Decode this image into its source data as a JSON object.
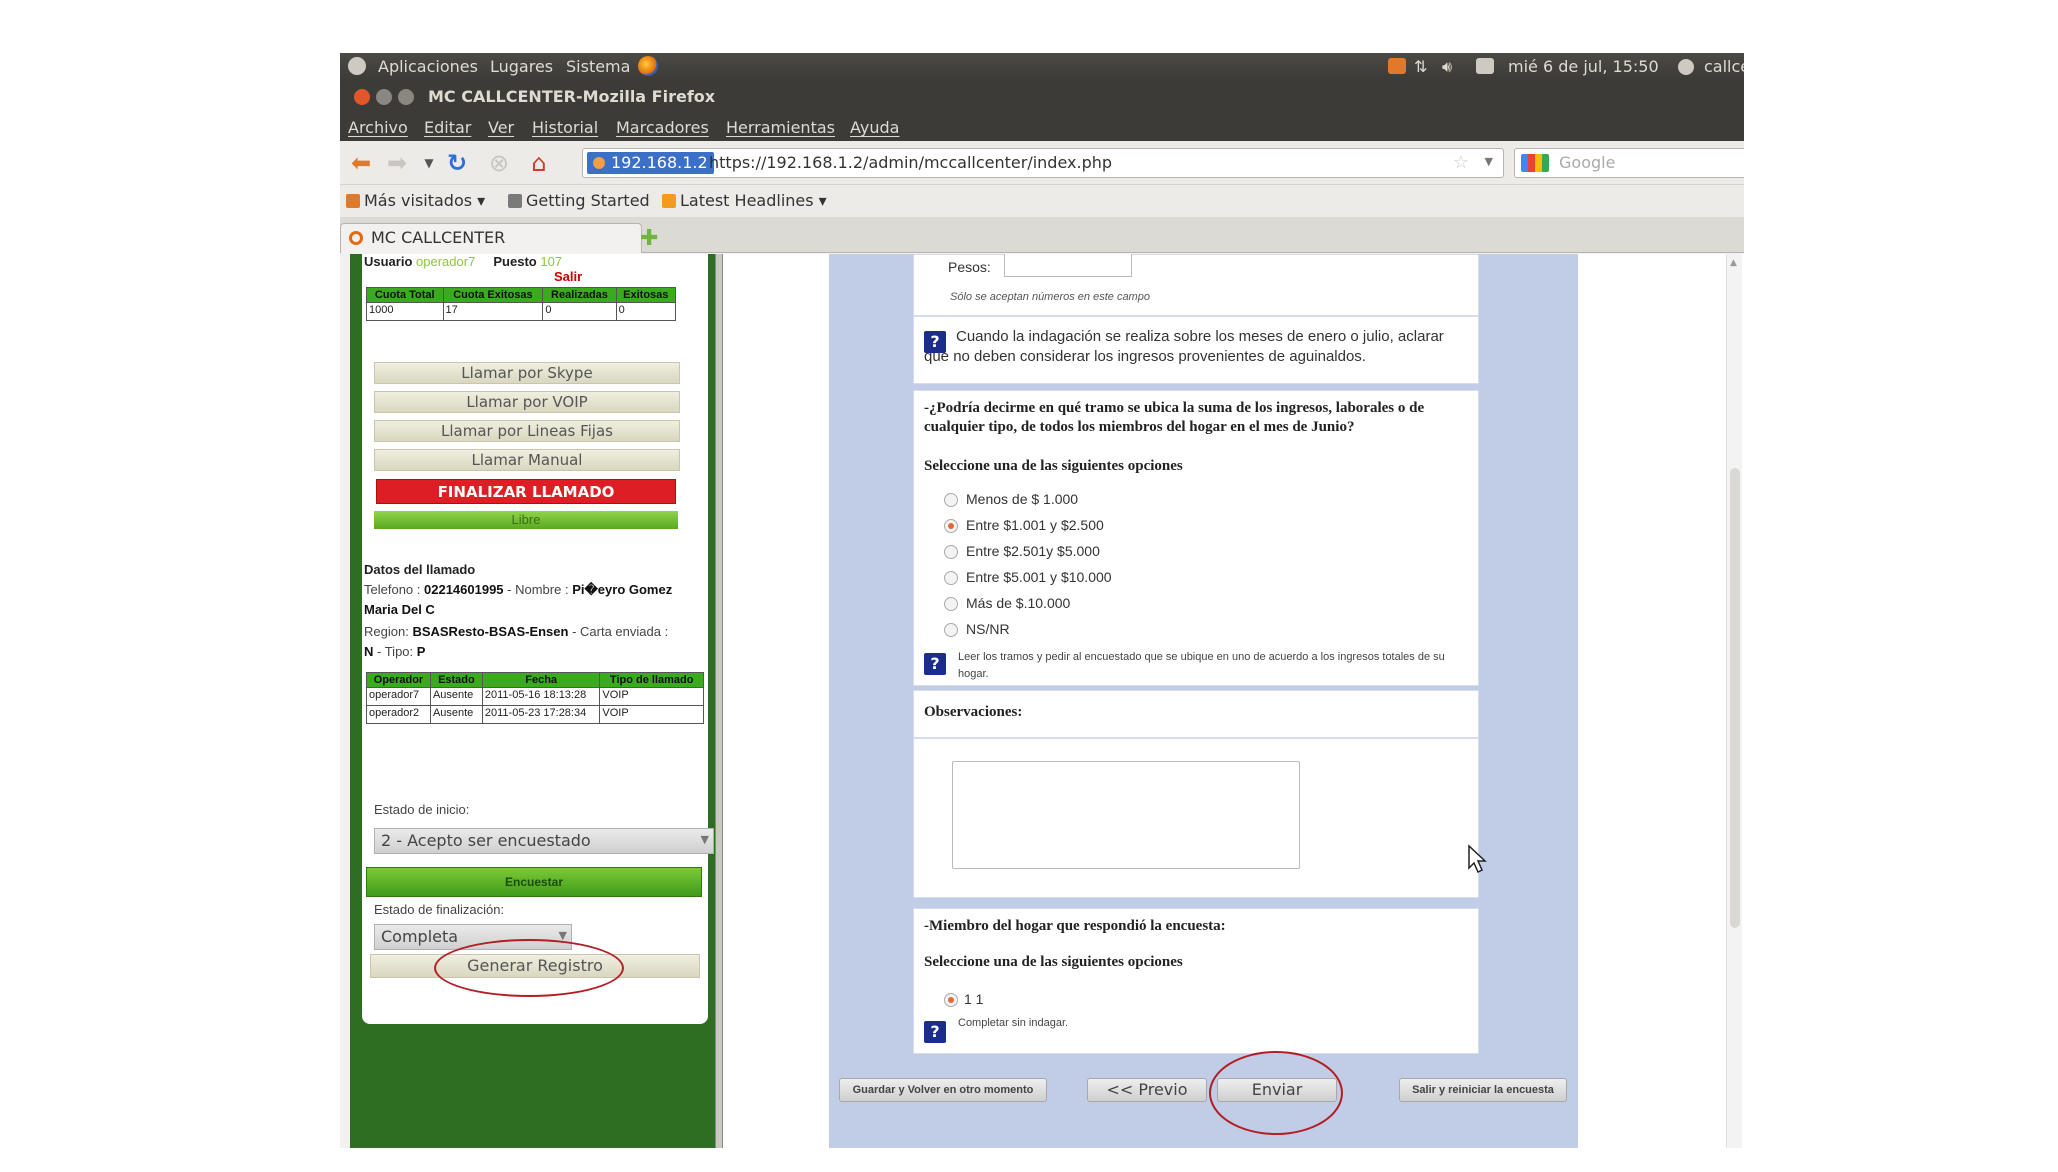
{
  "panel": {
    "menus": [
      "Aplicaciones",
      "Lugares",
      "Sistema"
    ],
    "clock": "mié 6 de jul, 15:50",
    "user": "callcen"
  },
  "window": {
    "title": "MC CALLCENTER-Mozilla Firefox"
  },
  "menubar": [
    "Archivo",
    "Editar",
    "Ver",
    "Historial",
    "Marcadores",
    "Herramientas",
    "Ayuda"
  ],
  "nav": {
    "site": "192.168.1.2",
    "url": "https://192.168.1.2/admin/mccallcenter/index.php",
    "search_placeholder": "Google"
  },
  "bookmarks": [
    "Más visitados ▾",
    "Getting Started",
    "Latest Headlines ▾"
  ],
  "tab": {
    "label": "MC CALLCENTER"
  },
  "left": {
    "usuario_label": "Usuario",
    "usuario": "operador7",
    "puesto_label": "Puesto",
    "puesto": "107",
    "salir": "Salir",
    "quota_headers": [
      "Cuota Total",
      "Cuota Exitosas",
      "Realizadas",
      "Exitosas"
    ],
    "quota_values": [
      "1000",
      "17",
      "0",
      "0"
    ],
    "call_buttons": [
      "Llamar por Skype",
      "Llamar por VOIP",
      "Llamar por Lineas Fijas",
      "Llamar Manual"
    ],
    "finalizar": "FINALIZAR LLAMADO",
    "libre": "Libre",
    "datos_title": "Datos del llamado",
    "telefono_label": "Telefono :",
    "telefono": "02214601995",
    "nombre_label": "- Nombre :",
    "nombre": "Pi�eyro Gomez",
    "nombre_cont": "Maria Del C",
    "region_label": "Region:",
    "region": "BSASResto-BSAS-Ensen",
    "carta_label": "- Carta enviada :",
    "carta": "N",
    "tipo_label": "- Tipo:",
    "tipo": "P",
    "hist_headers": [
      "Operador",
      "Estado",
      "Fecha",
      "Tipo de llamado"
    ],
    "hist_rows": [
      [
        "operador7",
        "Ausente",
        "2011-05-16 18:13:28",
        "VOIP"
      ],
      [
        "operador2",
        "Ausente",
        "2011-05-23 17:28:34",
        "VOIP"
      ]
    ],
    "estado_inicio_label": "Estado de inicio:",
    "estado_inicio": "2 - Acepto ser encuestado",
    "encuestar": "Encuestar",
    "estado_fin_label": "Estado de finalización:",
    "estado_fin": "Completa",
    "generar": "Generar Registro"
  },
  "survey": {
    "pesos_label": "Pesos:",
    "pesos_note": "Sólo se aceptan números en este campo",
    "hint1": "Cuando la indagación se realiza sobre los meses de enero o julio, aclarar que no deben considerar los ingresos provenientes de aguinaldos.",
    "q_ingresos": "-¿Podría decirme en qué tramo se ubica la suma de los ingresos, laborales o de cualquier tipo, de todos los miembros del hogar en el mes de Junio?",
    "q_ingresos_instr": "Seleccione una de las siguientes opciones",
    "options": [
      "Menos de $ 1.000",
      "Entre $1.001 y $2.500",
      "Entre $2.501y $5.000",
      "Entre $5.001 y $10.000",
      "Más de $.10.000",
      "NS/NR"
    ],
    "selected_option": 1,
    "hint2": "Leer los tramos y pedir al encuestado que se ubique en uno de acuerdo a los ingresos totales de su hogar.",
    "obs_label": "Observaciones:",
    "q_miembro": "-Miembro del hogar que respondió la encuesta:",
    "q_miembro_instr": "Seleccione una de las siguientes opciones",
    "miembro_option": "1 1",
    "hint3": "Completar sin indagar.",
    "btn_guardar": "Guardar y Volver en otro momento",
    "btn_previo": "<< Previo",
    "btn_enviar": "Enviar",
    "btn_salir": "Salir y reiniciar la encuesta"
  },
  "colors": {
    "left_frame": "#2d6e23",
    "finalizar": "#dd1e24",
    "survey_bg": "#c1cde6",
    "annotation": "#b31d23"
  }
}
